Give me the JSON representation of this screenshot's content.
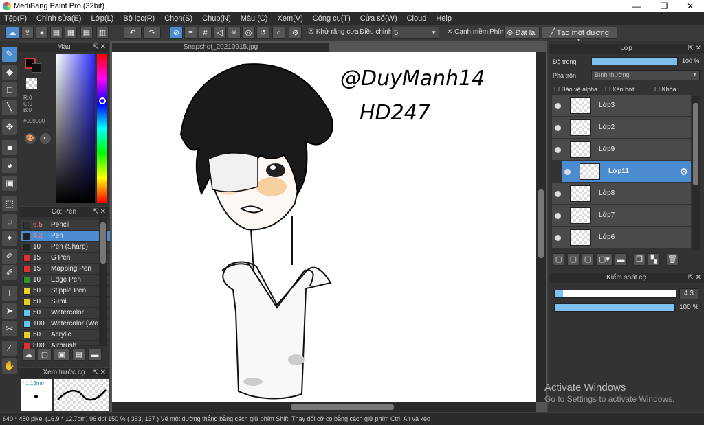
{
  "window": {
    "title": "MediBang Paint Pro (32bit)",
    "min": "—",
    "max": "❐",
    "close": "✕"
  },
  "menu": [
    "Tệp(F)",
    "Chỉnh sửa(E)",
    "Lớp(L)",
    "Bộ lọc(R)",
    "Chọn(S)",
    "Chụp(N)",
    "Màu (C)",
    "Xem(V)",
    "Công cụ(T)",
    "Cửa sổ(W)",
    "Cloud",
    "Help"
  ],
  "toolbar": {
    "antialias": "Khử răng cưa",
    "adjust": "Điều chỉnh",
    "adjust_value": "5",
    "smooth": "Cạnh mềm",
    "key_label": "Phím",
    "reset": "Đặt lại",
    "straight_line": "Tạo một đường thẳng"
  },
  "color_panel": {
    "title": "Màu",
    "r": "R:0",
    "g": "G:0",
    "b": "B:0",
    "hex": "#000000"
  },
  "brush_panel": {
    "title": "Cọ: Pen",
    "items": [
      {
        "size": "6.5",
        "name": "Pencil",
        "color": "#333333"
      },
      {
        "size": "4.3",
        "name": "Pen",
        "color": "#222222"
      },
      {
        "size": "10",
        "name": "Pen (Sharp)",
        "color": "#222222"
      },
      {
        "size": "15",
        "name": "G Pen",
        "color": "#e03030"
      },
      {
        "size": "15",
        "name": "Mapping Pen",
        "color": "#e03030"
      },
      {
        "size": "10",
        "name": "Edge Pen",
        "color": "#2a9a2a"
      },
      {
        "size": "50",
        "name": "Stipple Pen",
        "color": "#e8d020"
      },
      {
        "size": "50",
        "name": "Sumi",
        "color": "#e8d020"
      },
      {
        "size": "50",
        "name": "Watercolor",
        "color": "#60c8f0"
      },
      {
        "size": "100",
        "name": "Watercolor (We",
        "color": "#60c8f0"
      },
      {
        "size": "50",
        "name": "Acrylic",
        "color": "#e8d020"
      },
      {
        "size": "800",
        "name": "Airbrush",
        "color": "#e03030"
      }
    ]
  },
  "preview": {
    "title": "Xem trước cọ",
    "size": "* 1.13mm"
  },
  "canvas": {
    "tab": "Snapshot_20210915.jpg",
    "sign1": "@DuyManh14",
    "sign2": "HD247"
  },
  "layer_panel": {
    "title": "Lớp",
    "opacity_label": "Độ trong",
    "opacity_value": "100 %",
    "blend_label": "Pha trộn",
    "blend_value": "Bình thường",
    "protect_alpha": "Bảo vệ alpha",
    "clipping": "Xén bớt",
    "lock": "Khóa",
    "layers": [
      "Lớp3",
      "Lớp2",
      "Lớp9",
      "Lớp11",
      "Lớp8",
      "Lớp7",
      "Lớp6"
    ],
    "selected": "Lớp11"
  },
  "brush_control": {
    "title": "Kiểm soát cọ",
    "size": "4.3",
    "opacity": "100 %"
  },
  "status": {
    "text": "640 * 480 pixel   (16.9 * 12.7cm)   96 dpi   150 %   ( 363, 137 )   Vẽ một đường thẳng bằng cách giữ phím Shift, Thay đổi cỡ cọ bằng cách giữ phím Ctrl, Alt và kéo"
  },
  "watermark": {
    "line1": "Activate Windows",
    "line2": "Go to Settings to activate Windows."
  }
}
